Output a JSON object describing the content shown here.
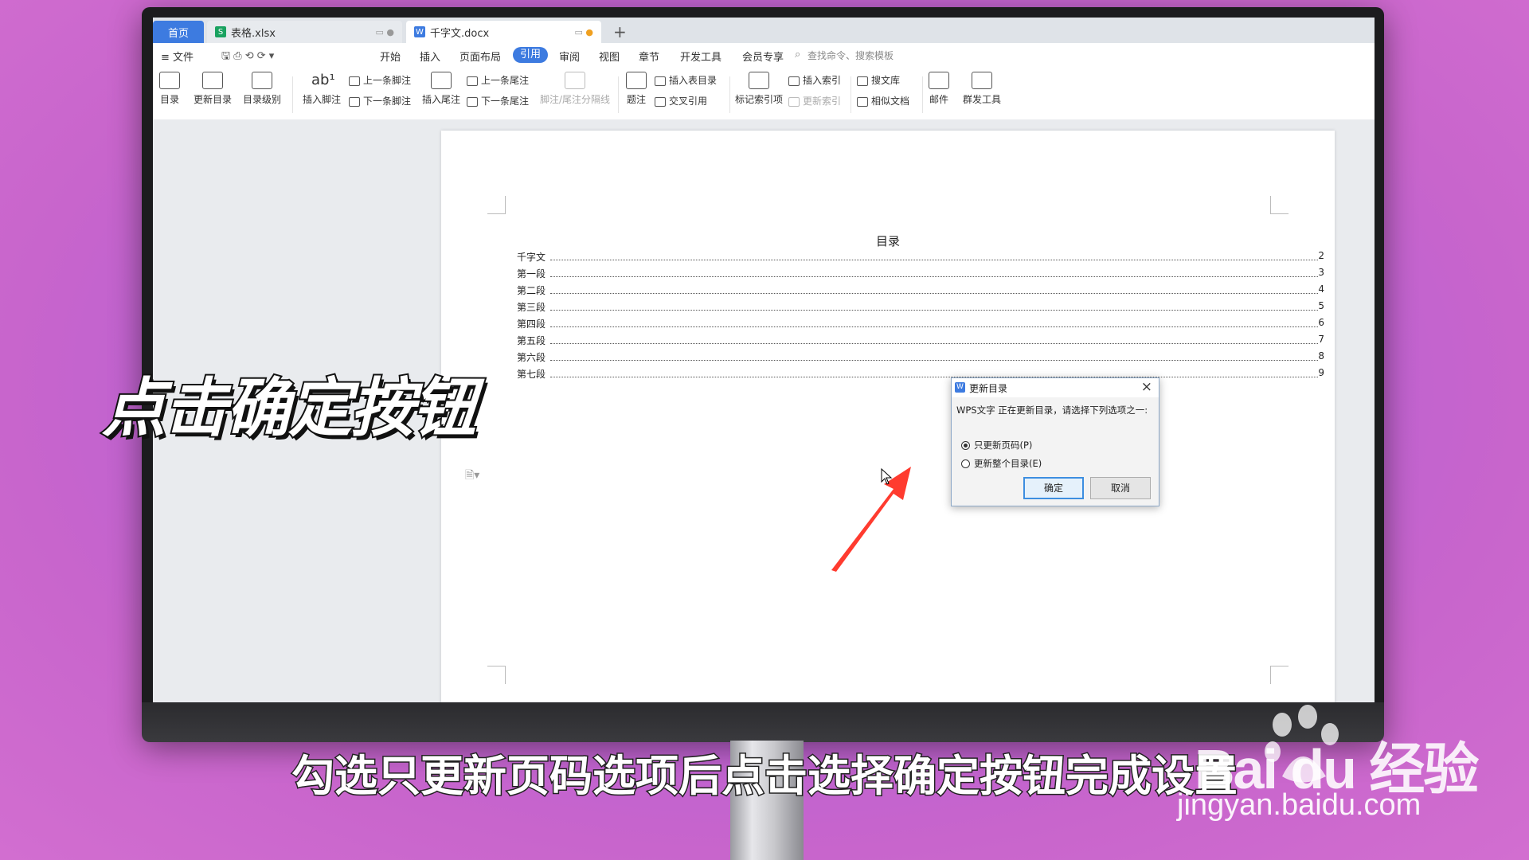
{
  "tabs": {
    "home": "首页",
    "xlsx": "表格.xlsx",
    "docx": "千字文.docx",
    "add": "+"
  },
  "menu": {
    "file": "≡ 文件",
    "items": [
      "开始",
      "插入",
      "页面布局",
      "引用",
      "审阅",
      "视图",
      "章节",
      "开发工具",
      "会员专享"
    ],
    "active": "引用",
    "search": "查找命令、搜索模板"
  },
  "ribbon": {
    "toc": "目录",
    "update_toc": "更新目录",
    "toc_level": "目录级别",
    "insert_footnote": "插入脚注",
    "prev_footnote": "上一条脚注",
    "next_footnote": "下一条脚注",
    "insert_endnote": "插入尾注",
    "prev_endnote": "上一条尾注",
    "next_endnote": "下一条尾注",
    "separator": "脚注/尾注分隔线",
    "caption": "题注",
    "insert_table_toc": "插入表目录",
    "cross_ref": "交叉引用",
    "mark_index": "标记索引项",
    "insert_index": "插入索引",
    "update_index": "更新索引",
    "search_lib": "搜文库",
    "similar_doc": "相似文档",
    "mail": "邮件",
    "mass_tool": "群发工具"
  },
  "document": {
    "toc_title": "目录",
    "entries": [
      {
        "label": "千字文",
        "page": "2"
      },
      {
        "label": "第一段",
        "page": "3"
      },
      {
        "label": "第二段",
        "page": "4"
      },
      {
        "label": "第三段",
        "page": "5"
      },
      {
        "label": "第四段",
        "page": "6"
      },
      {
        "label": "第五段",
        "page": "7"
      },
      {
        "label": "第六段",
        "page": "8"
      },
      {
        "label": "第七段",
        "page": "9"
      }
    ]
  },
  "dialog": {
    "title": "更新目录",
    "message": "WPS文字 正在更新目录，请选择下列选项之一:",
    "option1": "只更新页码(P)",
    "option2": "更新整个目录(E)",
    "selected": "option1",
    "ok": "确定",
    "cancel": "取消"
  },
  "overlay": {
    "instruction": "点击确定按钮",
    "subtitle": "勾选只更新页码选项后点击选择确定按钮完成设置"
  },
  "watermark": {
    "brand": "Bai du 经验",
    "url": "jingyan.baidu.com"
  },
  "colors": {
    "accent": "#3d7be0",
    "arrow": "#ff3b2f",
    "background": "#c865cc"
  }
}
